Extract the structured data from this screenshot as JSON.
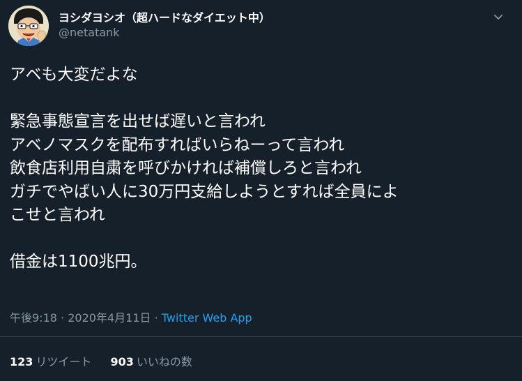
{
  "user": {
    "display_name": "ヨシダヨシオ（超ハードなダイエット中）",
    "handle": "@netatank"
  },
  "tweet": {
    "lines": [
      "アベも大変だよな",
      "",
      "緊急事態宣言を出せば遅いと言われ",
      "アベノマスクを配布すればいらねーって言われ",
      "飲食店利用自粛を呼びかければ補償しろと言われ",
      "ガチでやばい人に30万円支給しようとすれば全員によ",
      "こせと言われ",
      "",
      "借金は1100兆円。"
    ]
  },
  "meta": {
    "time": "午後9:18",
    "separator1": "·",
    "date": "2020年4月11日",
    "separator2": "·",
    "app": "Twitter Web App"
  },
  "stats": {
    "retweets_count": "123",
    "retweets_label": "リツイート",
    "likes_count": "903",
    "likes_label": "いいねの数"
  },
  "colors": {
    "background": "#15202b",
    "text": "#ffffff",
    "secondary": "#8899a6",
    "link": "#1da1f2",
    "divider": "#38444d"
  },
  "icons": {
    "avatar": "cartoon-avatar",
    "menu": "chevron-down-icon"
  }
}
